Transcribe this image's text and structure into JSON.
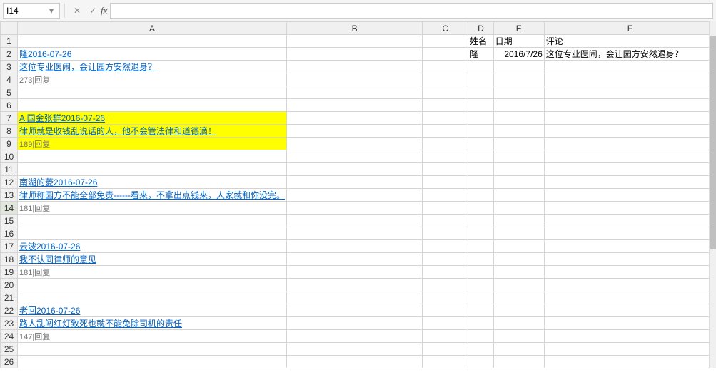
{
  "namebox": "I14",
  "formula": "",
  "columns": [
    "A",
    "B",
    "C",
    "D",
    "E",
    "F"
  ],
  "headers": {
    "D1": "姓名",
    "E1": "日期",
    "F1": "评论"
  },
  "rows": {
    "2": {
      "A": "隆2016-07-26",
      "D": "隆",
      "E": "2016/7/26",
      "F": "这位专业医闹，会让园方安然退身？"
    },
    "3": {
      "A": "这位专业医闹，会让园方安然退身？"
    },
    "4": {
      "A": "273|回复"
    },
    "7": {
      "A": "A 国金张群2016-07-26"
    },
    "8": {
      "A": "律师就是收钱乱说话的人，他不会管法律和道德滴！"
    },
    "9": {
      "A": "189|回复"
    },
    "12": {
      "A": "南湖的菱2016-07-26"
    },
    "13": {
      "A": "律师称园方不能全部免责------看来，不拿出点钱来，人家就和你没完。"
    },
    "14": {
      "A": "181|回复"
    },
    "17": {
      "A": "云波2016-07-26"
    },
    "18": {
      "A": "我不认同律师的意见"
    },
    "19": {
      "A": "181|回复"
    },
    "22": {
      "A": "老回2016-07-26"
    },
    "23": {
      "A": "路人乱闯红灯致死也就不能免除司机的责任"
    },
    "24": {
      "A": "147|回复"
    }
  },
  "hyperlink_rows": [
    2,
    3,
    7,
    8,
    12,
    13,
    17,
    18,
    22,
    23
  ],
  "gray_rows": [
    4,
    9,
    14,
    19,
    24
  ],
  "highlight_rows": [
    7,
    8,
    9
  ],
  "row_count": 26,
  "selected_cell": "I14"
}
